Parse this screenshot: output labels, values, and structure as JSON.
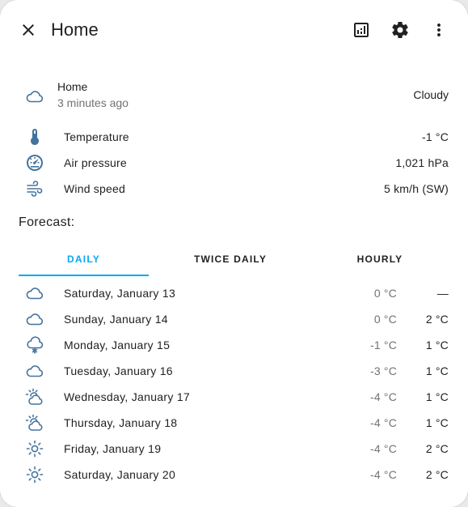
{
  "dialog": {
    "title": "Home",
    "close_icon": "close-icon",
    "history_icon": "chart-box-icon",
    "settings_icon": "gear-icon",
    "menu_icon": "dots-vertical-icon"
  },
  "entity": {
    "icon": "cloud-outline-icon",
    "name": "Home",
    "last_changed": "3 minutes ago",
    "state": "Cloudy"
  },
  "attributes": [
    {
      "icon": "thermometer-icon",
      "label": "Temperature",
      "value": "-1 °C"
    },
    {
      "icon": "gauge-icon",
      "label": "Air pressure",
      "value": "1,021 hPa"
    },
    {
      "icon": "wind-icon",
      "label": "Wind speed",
      "value": "5 km/h (SW)"
    }
  ],
  "forecast": {
    "title": "Forecast:",
    "tabs": [
      {
        "label": "DAILY",
        "active": true
      },
      {
        "label": "TWICE DAILY",
        "active": false
      },
      {
        "label": "HOURLY",
        "active": false
      }
    ],
    "days": [
      {
        "icon": "cloud-outline-icon",
        "day": "Saturday, January 13",
        "low": "0 °C",
        "high": "—"
      },
      {
        "icon": "cloud-outline-icon",
        "day": "Sunday, January 14",
        "low": "0 °C",
        "high": "2 °C"
      },
      {
        "icon": "snowy-icon",
        "day": "Monday, January 15",
        "low": "-1 °C",
        "high": "1 °C"
      },
      {
        "icon": "cloud-outline-icon",
        "day": "Tuesday, January 16",
        "low": "-3 °C",
        "high": "1 °C"
      },
      {
        "icon": "partly-cloudy-icon",
        "day": "Wednesday, January 17",
        "low": "-4 °C",
        "high": "1 °C"
      },
      {
        "icon": "partly-cloudy-icon",
        "day": "Thursday, January 18",
        "low": "-4 °C",
        "high": "1 °C"
      },
      {
        "icon": "sunny-icon",
        "day": "Friday, January 19",
        "low": "-4 °C",
        "high": "2 °C"
      },
      {
        "icon": "sunny-icon",
        "day": "Saturday, January 20",
        "low": "-4 °C",
        "high": "2 °C"
      }
    ]
  },
  "colors": {
    "accent": "#03a9f4",
    "icon": "#44739e",
    "secondary_text": "#727272"
  }
}
